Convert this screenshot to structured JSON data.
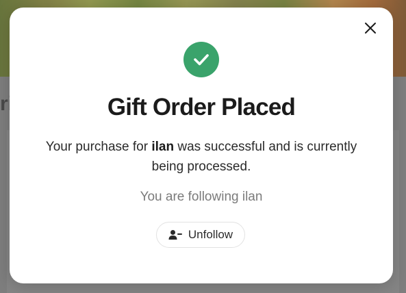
{
  "background": {
    "partial_heading": "ris"
  },
  "modal": {
    "close_icon": "close-icon",
    "success_icon": "check-circle-icon",
    "title": "Gift Order Placed",
    "message_prefix": "Your purchase for ",
    "recipient": "ilan",
    "message_suffix": " was successful and is currently being processed.",
    "following_text": "You are following ilan",
    "unfollow_button": {
      "label": "Unfollow",
      "icon": "user-minus-icon"
    },
    "colors": {
      "success": "#3aa36b",
      "title": "#1b1b1b",
      "muted": "#7b7b7b"
    }
  }
}
